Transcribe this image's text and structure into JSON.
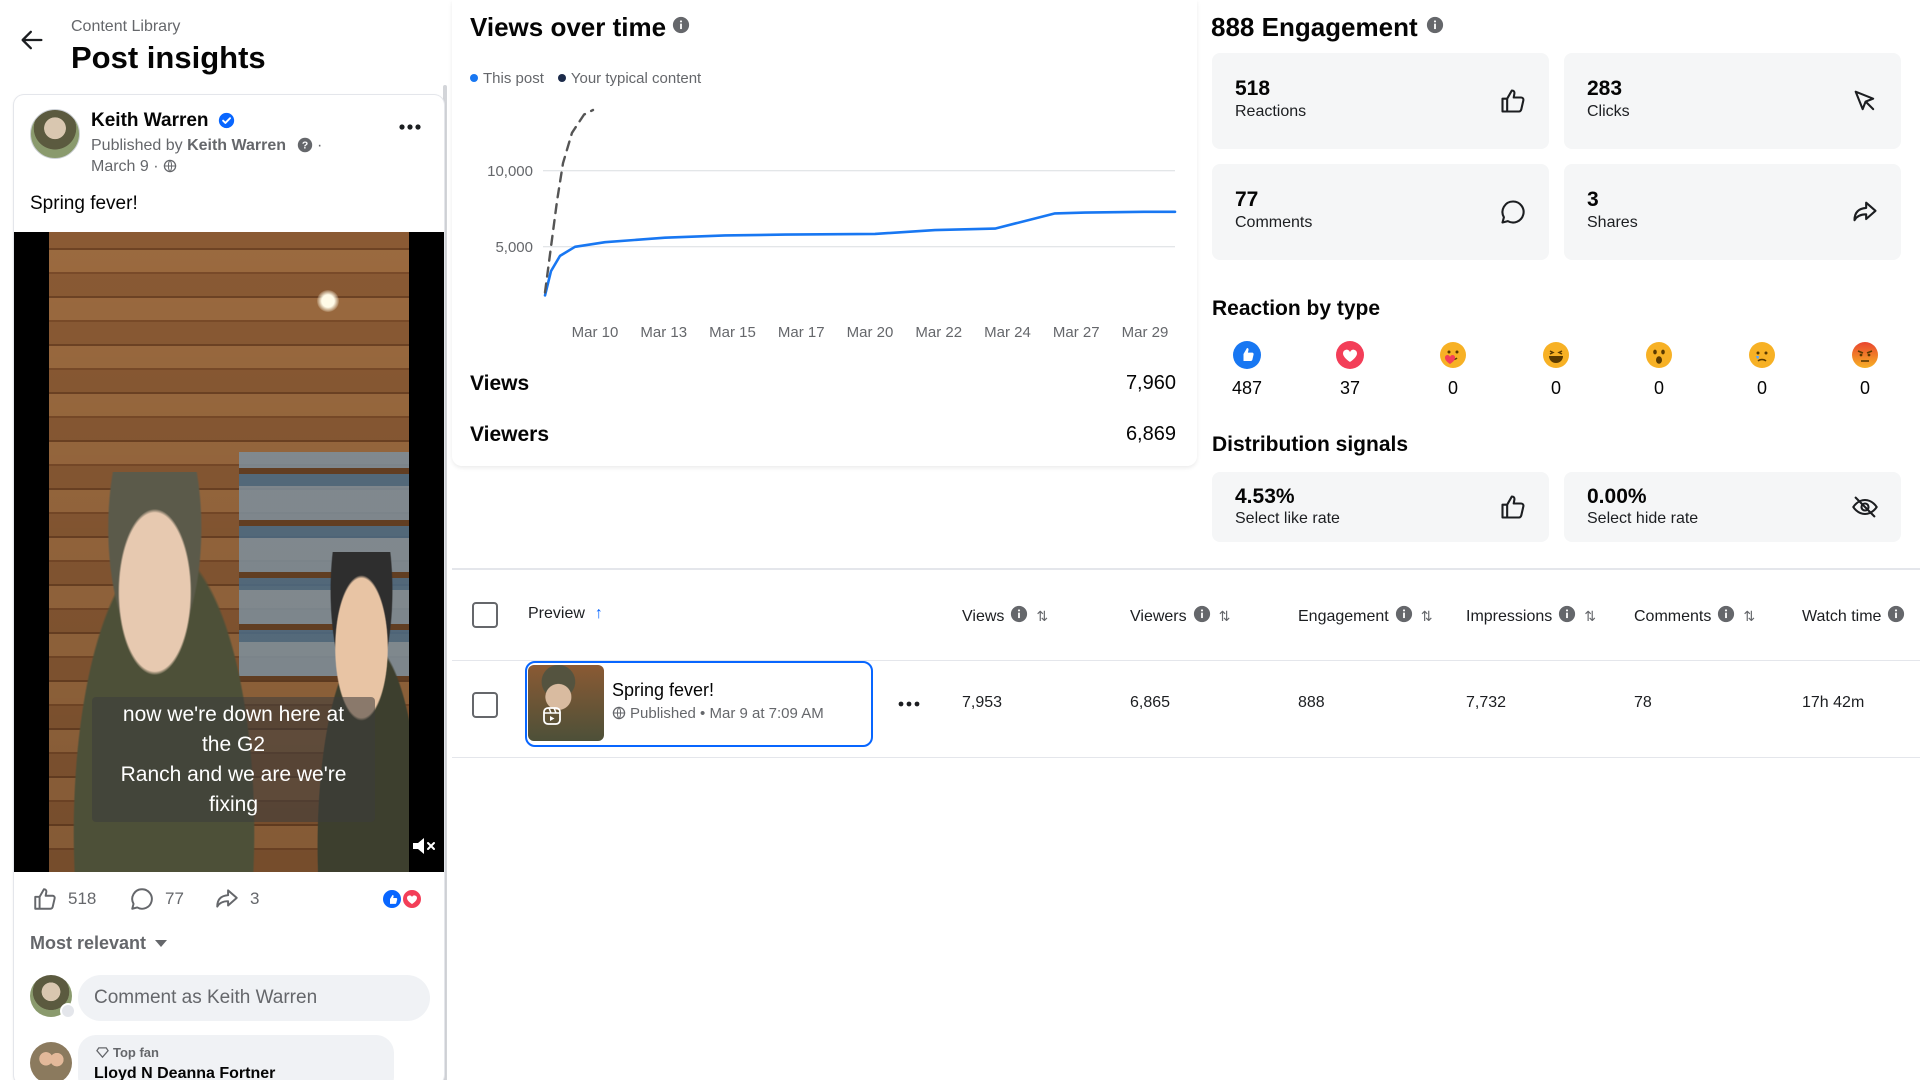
{
  "header": {
    "breadcrumb": "Content Library",
    "title": "Post insights"
  },
  "post": {
    "author": "Keith Warren",
    "published_by_prefix": "Published by",
    "published_by_name": "Keith Warren",
    "published_by_suffix": " ·",
    "date": "March 9 ·",
    "text": "Spring fever!",
    "caption_lines": [
      "now we're down here at",
      "the G2",
      "Ranch and we are we're",
      "fixing"
    ],
    "stats": {
      "likes": "518",
      "comments": "77",
      "shares": "3"
    },
    "sort_label": "Most relevant",
    "comment_placeholder": "Comment as Keith Warren",
    "top_fan_badge": "Top fan",
    "top_fan_name": "Lloyd N Deanna Fortner"
  },
  "views": {
    "title": "Views over time",
    "legend": [
      {
        "label": "This post",
        "color": "#1877f2"
      },
      {
        "label": "Your typical content",
        "color": "#1c2b4a"
      }
    ],
    "views_label": "Views",
    "views_value": "7,960",
    "viewers_label": "Viewers",
    "viewers_value": "6,869"
  },
  "chart_data": {
    "type": "line",
    "x_tick_labels": [
      "Mar 10",
      "Mar 13",
      "Mar 15",
      "Mar 17",
      "Mar 20",
      "Mar 22",
      "Mar 24",
      "Mar 27",
      "Mar 29"
    ],
    "y_tick_labels": [
      "5,000",
      "10,000"
    ],
    "y_ticks": [
      5000,
      10000
    ],
    "ylim": [
      1500,
      14000
    ],
    "grid": true,
    "series": [
      {
        "name": "This post",
        "color": "#1877f2",
        "style": "solid",
        "points": [
          [
            9.0,
            1800
          ],
          [
            9.2,
            3400
          ],
          [
            9.5,
            4400
          ],
          [
            10,
            5000
          ],
          [
            11,
            5300
          ],
          [
            13,
            5600
          ],
          [
            15,
            5750
          ],
          [
            17,
            5800
          ],
          [
            20,
            5850
          ],
          [
            22,
            6100
          ],
          [
            24,
            6200
          ],
          [
            26,
            7200
          ],
          [
            27,
            7250
          ],
          [
            29,
            7300
          ],
          [
            30,
            7300
          ]
        ]
      },
      {
        "name": "Your typical content",
        "color": "#555555",
        "style": "dashed",
        "points": [
          [
            9.0,
            2000
          ],
          [
            9.2,
            5000
          ],
          [
            9.4,
            8000
          ],
          [
            9.6,
            10500
          ],
          [
            9.9,
            12500
          ],
          [
            10.3,
            13700
          ],
          [
            10.6,
            14000
          ]
        ]
      }
    ]
  },
  "engagement": {
    "title": "888 Engagement",
    "cards": {
      "reactions": {
        "value": "518",
        "label": "Reactions"
      },
      "clicks": {
        "value": "283",
        "label": "Clicks"
      },
      "comments": {
        "value": "77",
        "label": "Comments"
      },
      "shares": {
        "value": "3",
        "label": "Shares"
      }
    },
    "reaction_title": "Reaction by type",
    "reactions": [
      {
        "type": "like-icon",
        "count": "487"
      },
      {
        "type": "love-icon",
        "count": "37"
      },
      {
        "type": "care-icon",
        "count": "0"
      },
      {
        "type": "haha-icon",
        "count": "0"
      },
      {
        "type": "wow-icon",
        "count": "0"
      },
      {
        "type": "sad-icon",
        "count": "0"
      },
      {
        "type": "angry-icon",
        "count": "0"
      }
    ],
    "distribution_title": "Distribution signals",
    "like_rate": {
      "value": "4.53%",
      "label": "Select like rate"
    },
    "hide_rate": {
      "value": "0.00%",
      "label": "Select hide rate"
    }
  },
  "table": {
    "headers": {
      "preview": "Preview",
      "views": "Views",
      "viewers": "Viewers",
      "engagement": "Engagement",
      "impressions": "Impressions",
      "comments": "Comments",
      "watch_time": "Watch time"
    },
    "row": {
      "title": "Spring fever!",
      "status": "Published",
      "published_at": " • Mar 9 at 7:09 AM",
      "views": "7,953",
      "viewers": "6,865",
      "engagement": "888",
      "impressions": "7,732",
      "comments": "78",
      "watch_time": "17h 42m"
    }
  },
  "colors": {
    "accent": "#0866ff",
    "chart_line": "#1877f2",
    "card_bg": "#f5f6f7"
  }
}
